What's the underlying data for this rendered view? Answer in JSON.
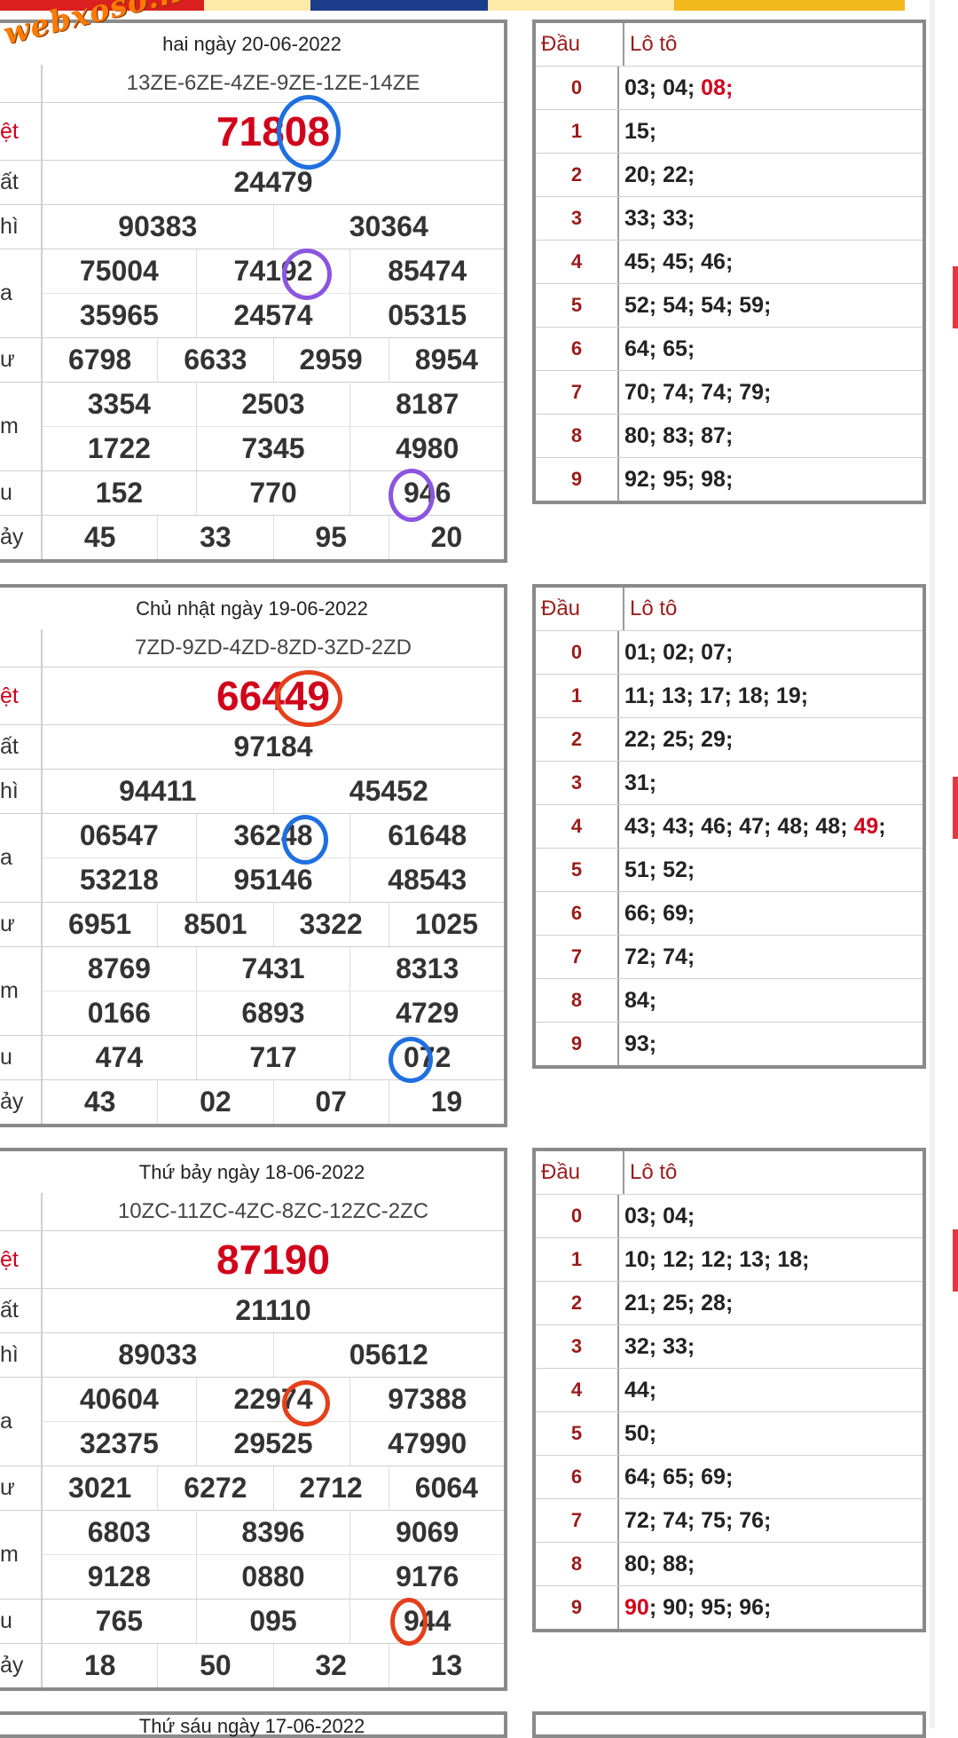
{
  "watermark": "webxoso.net",
  "colors": {
    "special_prize": "#d0021b",
    "head_digit": "#9b1b1b",
    "border": "#8a8a8a",
    "circle_blue": "#1f6fe0",
    "circle_purple": "#8a55e0",
    "circle_red": "#e3401c"
  },
  "draws": [
    {
      "date": "hai ngày 20-06-2022",
      "code": "13ZE-6ZE-4ZE-9ZE-1ZE-14ZE",
      "rows": [
        {
          "label": "ệt",
          "lines": [
            [
              "71808"
            ]
          ]
        },
        {
          "label": "ất",
          "lines": [
            [
              "24479"
            ]
          ]
        },
        {
          "label": "hì",
          "lines": [
            [
              "90383",
              "30364"
            ]
          ]
        },
        {
          "label": "a",
          "lines": [
            [
              "75004",
              "74192",
              "85474"
            ],
            [
              "35965",
              "24574",
              "05315"
            ]
          ]
        },
        {
          "label": "ư",
          "lines": [
            [
              "6798",
              "6633",
              "2959",
              "8954"
            ]
          ]
        },
        {
          "label": "m",
          "lines": [
            [
              "3354",
              "2503",
              "8187"
            ],
            [
              "1722",
              "7345",
              "4980"
            ]
          ]
        },
        {
          "label": "u",
          "lines": [
            [
              "152",
              "770",
              "946"
            ]
          ]
        },
        {
          "label": "ảy",
          "lines": [
            [
              "45",
              "33",
              "95",
              "20"
            ]
          ]
        }
      ],
      "loto_header": {
        "dau": "Đầu",
        "loto": "Lô tô"
      },
      "loto": [
        {
          "d": "0",
          "v": "03; 04;",
          "hl": "08;"
        },
        {
          "d": "1",
          "v": "15;"
        },
        {
          "d": "2",
          "v": "20; 22;"
        },
        {
          "d": "3",
          "v": "33; 33;"
        },
        {
          "d": "4",
          "v": "45; 45; 46;"
        },
        {
          "d": "5",
          "v": "52; 54; 54; 59;"
        },
        {
          "d": "6",
          "v": "64; 65;"
        },
        {
          "d": "7",
          "v": "70; 74; 74; 79;"
        },
        {
          "d": "8",
          "v": "80; 83; 87;"
        },
        {
          "d": "9",
          "v": "92; 95; 98;"
        }
      ]
    },
    {
      "date": "Chủ nhật ngày 19-06-2022",
      "code": "7ZD-9ZD-4ZD-8ZD-3ZD-2ZD",
      "rows": [
        {
          "label": "ệt",
          "lines": [
            [
              "66449"
            ]
          ]
        },
        {
          "label": "ất",
          "lines": [
            [
              "97184"
            ]
          ]
        },
        {
          "label": "hì",
          "lines": [
            [
              "94411",
              "45452"
            ]
          ]
        },
        {
          "label": "a",
          "lines": [
            [
              "06547",
              "36248",
              "61648"
            ],
            [
              "53218",
              "95146",
              "48543"
            ]
          ]
        },
        {
          "label": "ư",
          "lines": [
            [
              "6951",
              "8501",
              "3322",
              "1025"
            ]
          ]
        },
        {
          "label": "m",
          "lines": [
            [
              "8769",
              "7431",
              "8313"
            ],
            [
              "0166",
              "6893",
              "4729"
            ]
          ]
        },
        {
          "label": "u",
          "lines": [
            [
              "474",
              "717",
              "072"
            ]
          ]
        },
        {
          "label": "ảy",
          "lines": [
            [
              "43",
              "02",
              "07",
              "19"
            ]
          ]
        }
      ],
      "loto_header": {
        "dau": "Đầu",
        "loto": "Lô tô"
      },
      "loto": [
        {
          "d": "0",
          "v": "01; 02; 07;"
        },
        {
          "d": "1",
          "v": "11; 13; 17; 18; 19;"
        },
        {
          "d": "2",
          "v": "22; 25; 29;"
        },
        {
          "d": "3",
          "v": "31;"
        },
        {
          "d": "4",
          "v": "43; 43; 46; 47; 48; 48;",
          "hl": "49",
          "tail": ";"
        },
        {
          "d": "5",
          "v": "51; 52;"
        },
        {
          "d": "6",
          "v": "66; 69;"
        },
        {
          "d": "7",
          "v": "72; 74;"
        },
        {
          "d": "8",
          "v": "84;"
        },
        {
          "d": "9",
          "v": "93;"
        }
      ]
    },
    {
      "date": "Thứ bảy ngày 18-06-2022",
      "code": "10ZC-11ZC-4ZC-8ZC-12ZC-2ZC",
      "rows": [
        {
          "label": "ệt",
          "lines": [
            [
              "87190"
            ]
          ]
        },
        {
          "label": "ất",
          "lines": [
            [
              "21110"
            ]
          ]
        },
        {
          "label": "hì",
          "lines": [
            [
              "89033",
              "05612"
            ]
          ]
        },
        {
          "label": "a",
          "lines": [
            [
              "40604",
              "22974",
              "97388"
            ],
            [
              "32375",
              "29525",
              "47990"
            ]
          ]
        },
        {
          "label": "ư",
          "lines": [
            [
              "3021",
              "6272",
              "2712",
              "6064"
            ]
          ]
        },
        {
          "label": "m",
          "lines": [
            [
              "6803",
              "8396",
              "9069"
            ],
            [
              "9128",
              "0880",
              "9176"
            ]
          ]
        },
        {
          "label": "u",
          "lines": [
            [
              "765",
              "095",
              "944"
            ]
          ]
        },
        {
          "label": "ảy",
          "lines": [
            [
              "18",
              "50",
              "32",
              "13"
            ]
          ]
        }
      ],
      "loto_header": {
        "dau": "Đầu",
        "loto": "Lô tô"
      },
      "loto": [
        {
          "d": "0",
          "v": "03; 04;"
        },
        {
          "d": "1",
          "v": "10; 12; 12; 13; 18;"
        },
        {
          "d": "2",
          "v": "21; 25; 28;"
        },
        {
          "d": "3",
          "v": "32; 33;"
        },
        {
          "d": "4",
          "v": "44;"
        },
        {
          "d": "5",
          "v": "50;"
        },
        {
          "d": "6",
          "v": "64; 65; 69;"
        },
        {
          "d": "7",
          "v": "72; 74; 75; 76;"
        },
        {
          "d": "8",
          "v": "80; 88;"
        },
        {
          "hlfirst": "90",
          "d": "9",
          "v": "; 90; 95; 96;"
        }
      ]
    }
  ],
  "next_date_partial": "Thứ sáu ngày 17-06-2022"
}
